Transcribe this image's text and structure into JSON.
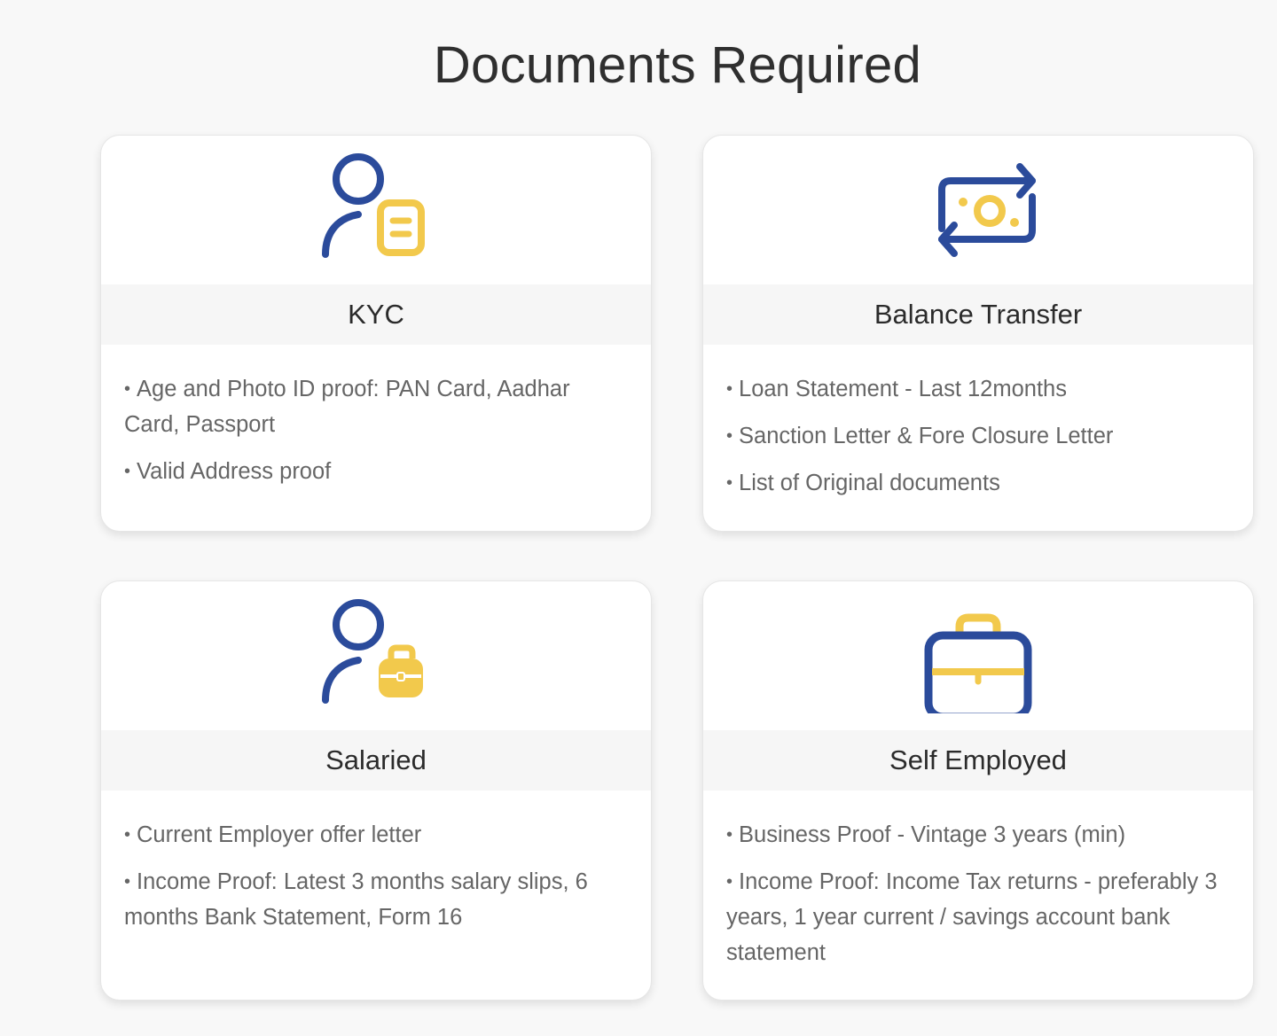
{
  "page": {
    "title": "Documents Required"
  },
  "colors": {
    "brand_blue": "#2b4b9b",
    "brand_yellow": "#f2c94c",
    "text_dark": "#2b2b2b",
    "text_muted": "#666666",
    "card_header_bg": "#f6f6f6"
  },
  "cards": [
    {
      "icon": "user-document-icon",
      "heading": "KYC",
      "items": [
        "Age and Photo ID proof: PAN Card, Aadhar Card, Passport",
        "Valid Address proof"
      ]
    },
    {
      "icon": "money-transfer-icon",
      "heading": "Balance Transfer",
      "items": [
        "Loan Statement - Last 12months",
        "Sanction Letter & Fore Closure Letter",
        "List of Original documents"
      ]
    },
    {
      "icon": "user-briefcase-icon",
      "heading": "Salaried",
      "items": [
        "Current Employer offer letter",
        "Income Proof: Latest 3 months salary slips, 6 months Bank Statement, Form 16"
      ]
    },
    {
      "icon": "briefcase-icon",
      "heading": "Self Employed",
      "items": [
        "Business Proof - Vintage 3 years (min)",
        "Income Proof: Income Tax returns - preferably 3 years, 1 year current / savings account bank statement"
      ]
    }
  ]
}
